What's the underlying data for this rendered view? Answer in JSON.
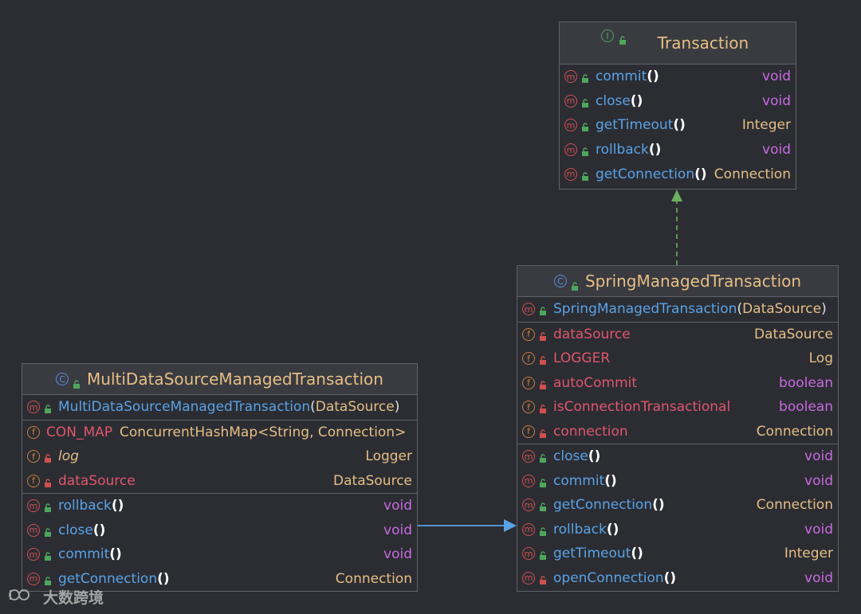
{
  "colors": {
    "background": "#2b2d33",
    "header_bg": "#393b41",
    "border": "#5f6268",
    "class_name": "#e6be84",
    "method_name": "#5aa3e6",
    "field_name": "#e0566a",
    "keyword_type": "#c96ae0",
    "implements_arrow": "#69b05d",
    "extends_arrow": "#5aa3e6"
  },
  "transaction": {
    "kind_icon": "interface-icon",
    "title": "Transaction",
    "methods": [
      {
        "name": "commit",
        "parens": "()",
        "type": "void"
      },
      {
        "name": "close",
        "parens": "()",
        "type": "void"
      },
      {
        "name": "getTimeout",
        "parens": "()",
        "type": "Integer"
      },
      {
        "name": "rollback",
        "parens": "()",
        "type": "void"
      },
      {
        "name": "getConnection",
        "parens": "()",
        "type": "Connection"
      }
    ]
  },
  "spring": {
    "kind_icon": "class-icon",
    "title": "SpringManagedTransaction",
    "ctor": {
      "name": "SpringManagedTransaction",
      "open": "(",
      "arg": "DataSource",
      "close": ")"
    },
    "fields": [
      {
        "name": "dataSource",
        "type": "DataSource"
      },
      {
        "name": "LOGGER",
        "type": "Log"
      },
      {
        "name": "autoCommit",
        "type": "boolean"
      },
      {
        "name": "isConnectionTransactional",
        "type": "boolean"
      },
      {
        "name": "connection",
        "type": "Connection"
      }
    ],
    "methods": [
      {
        "name": "close",
        "parens": "()",
        "type": "void"
      },
      {
        "name": "commit",
        "parens": "()",
        "type": "void"
      },
      {
        "name": "getConnection",
        "parens": "()",
        "type": "Connection"
      },
      {
        "name": "rollback",
        "parens": "()",
        "type": "void"
      },
      {
        "name": "getTimeout",
        "parens": "()",
        "type": "Integer"
      },
      {
        "name": "openConnection",
        "parens": "()",
        "type": "void"
      }
    ]
  },
  "multi": {
    "kind_icon": "class-icon",
    "title": "MultiDataSourceManagedTransaction",
    "ctor": {
      "name": "MultiDataSourceManagedTransaction",
      "open": "(",
      "arg": "DataSource",
      "close": ")"
    },
    "fields": [
      {
        "name": "CON_MAP",
        "type": "ConcurrentHashMap<String, Connection>"
      },
      {
        "name": "log",
        "type": "Logger"
      },
      {
        "name": "dataSource",
        "type": "DataSource"
      }
    ],
    "methods": [
      {
        "name": "rollback",
        "parens": "()",
        "type": "void"
      },
      {
        "name": "close",
        "parens": "()",
        "type": "void"
      },
      {
        "name": "commit",
        "parens": "()",
        "type": "void"
      },
      {
        "name": "getConnection",
        "parens": "()",
        "type": "Connection"
      }
    ]
  },
  "watermark": {
    "text": "大数跨境"
  }
}
